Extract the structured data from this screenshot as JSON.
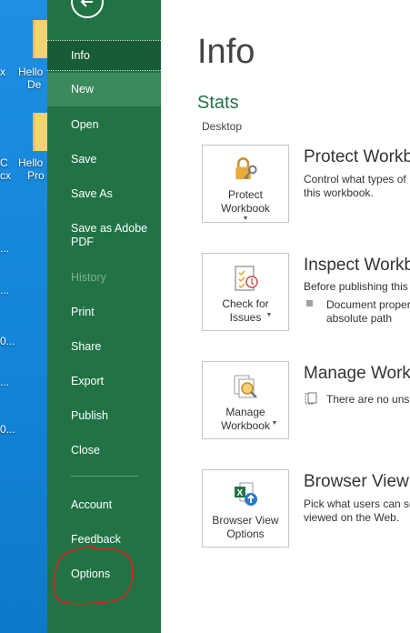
{
  "desktop": {
    "labels": [
      "x",
      "Hello\n   De",
      "C\ncx",
      "Hello\n   Pro",
      "...",
      "...",
      "0...",
      "...",
      "0..."
    ]
  },
  "backstage": {
    "items": [
      {
        "label": "Info",
        "state": "active"
      },
      {
        "label": "New",
        "state": "hover"
      },
      {
        "label": "Open",
        "state": "normal"
      },
      {
        "label": "Save",
        "state": "normal"
      },
      {
        "label": "Save As",
        "state": "normal"
      },
      {
        "label": "Save as Adobe\nPDF",
        "state": "normal"
      },
      {
        "label": "History",
        "state": "disabled"
      },
      {
        "label": "Print",
        "state": "normal"
      },
      {
        "label": "Share",
        "state": "normal"
      },
      {
        "label": "Export",
        "state": "normal"
      },
      {
        "label": "Publish",
        "state": "normal"
      },
      {
        "label": "Close",
        "state": "normal"
      },
      {
        "label": "Account",
        "state": "normal"
      },
      {
        "label": "Feedback",
        "state": "normal"
      },
      {
        "label": "Options",
        "state": "normal"
      }
    ],
    "colors": {
      "pane": "#217346",
      "active": "#185c37",
      "hover": "#3a8a5d",
      "annotation": "#e02020"
    }
  },
  "main": {
    "title": "Info",
    "section": "Stats",
    "location": "Desktop",
    "cards": [
      {
        "tile_label": "Protect\nWorkbook",
        "title": "Protect Workbook",
        "desc": "Control what types of\nthis workbook.",
        "icon": "lock-key-icon"
      },
      {
        "tile_label": "Check for\nIssues",
        "title": "Inspect Workbook",
        "desc": "Before publishing this",
        "bullet": "Document proper\nabsolute path",
        "icon": "checklist-icon"
      },
      {
        "tile_label": "Manage\nWorkbook",
        "title": "Manage Workbook",
        "note": "There are no unsa",
        "icon": "search-docs-icon"
      },
      {
        "tile_label": "Browser View\nOptions",
        "title": "Browser View O",
        "desc": "Pick what users can se\nviewed on the Web.",
        "icon": "excel-globe-icon"
      }
    ]
  }
}
